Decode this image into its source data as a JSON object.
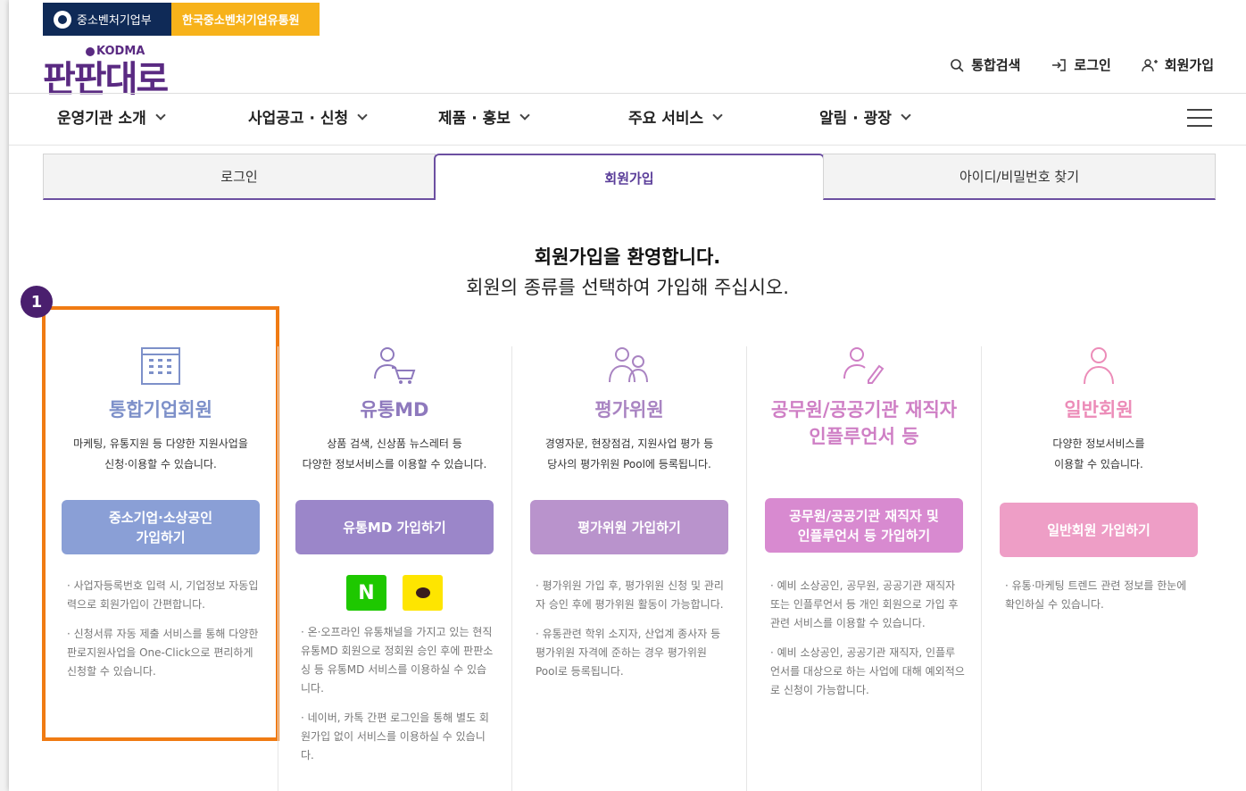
{
  "gov_bar": {
    "ministry": "중소벤처기업부",
    "agency": "한국중소벤처기업유통원"
  },
  "logo": {
    "text": "판판대로",
    "sub": "KODMA"
  },
  "utility": {
    "search": "통합검색",
    "login": "로그인",
    "signup": "회원가입"
  },
  "main_nav": [
    "운영기관 소개",
    "사업공고 · 신청",
    "제품 · 홍보",
    "주요 서비스",
    "알림 · 광장"
  ],
  "tabs": [
    "로그인",
    "회원가입",
    "아이디/비밀번호 찾기"
  ],
  "welcome": {
    "title": "회원가입을 환영합니다.",
    "subtitle": "회원의 종류를 선택하여 가입해 주십시오."
  },
  "badge": "1",
  "columns": [
    {
      "title": "통합기업회원",
      "desc1": "마케팅, 유통지원 등 다양한 지원사업을",
      "desc2": "신청·이용할 수 있습니다.",
      "button": "중소기업·소상공인\n가입하기",
      "notes": [
        "· 사업자등록번호 입력 시, 기업정보 자동입력으로 회원가입이 간편합니다.",
        "· 신청서류 자동 제출 서비스를 통해 다양한 판로지원사업을 One-Click으로 편리하게 신청할 수 있습니다."
      ]
    },
    {
      "title": "유통MD",
      "desc1": "상품 검색, 신상품 뉴스레터 등",
      "desc2": "다양한 정보서비스를 이용할 수 있습니다.",
      "button": "유통MD 가입하기",
      "sns": [
        "N",
        "kakao"
      ],
      "notes": [
        "· 온·오프라인 유통채널을 가지고 있는 현직 유통MD 회원으로 정회원 승인 후에 판판소싱 등 유통MD 서비스를 이용하실 수 있습니다.",
        "· 네이버, 카톡 간편 로그인을 통해 별도 회원가입 없이 서비스를 이용하실 수 있습니다."
      ]
    },
    {
      "title": "평가위원",
      "desc1": "경영자문, 현장점검, 지원사업 평가 등",
      "desc2": "당사의 평가위원 Pool에 등록됩니다.",
      "button": "평가위원 가입하기",
      "notes": [
        "· 평가위원 가입 후, 평가위원 신청 및 관리자 승인 후에 평가위원 활동이 가능합니다.",
        "· 유통관련 학위 소지자, 산업계 종사자 등 평가위원 자격에 준하는 경우 평가위원 Pool로 등록됩니다."
      ]
    },
    {
      "title": "공무원/공공기관 재직자\n인플루언서 등",
      "desc1": "",
      "desc2": "",
      "button": "공무원/공공기관 재직자 및\n인플루언서 등 가입하기",
      "notes": [
        "· 예비 소상공인, 공무원, 공공기관 재직자 또는 인플루언서 등 개인 회원으로 가입 후 관련 서비스를 이용할 수 있습니다.",
        "· 예비 소상공인, 공공기관 재직자, 인플루언서를 대상으로 하는 사업에 대해 예외적으로 신청이 가능합니다."
      ]
    },
    {
      "title": "일반회원",
      "desc1": "다양한 정보서비스를",
      "desc2": "이용할 수 있습니다.",
      "button": "일반회원 가입하기",
      "notes": [
        "· 유통·마케팅 트렌드 관련 정보를 한눈에 확인하실 수 있습니다."
      ]
    }
  ],
  "colors": {
    "purple_dark": "#5a2a82",
    "tab_accent": "#6c4fa1",
    "highlight": "#f07b13",
    "col1": "#8a9fd6",
    "col2": "#9b86c9",
    "col3": "#b993cc",
    "col4": "#d88ad0",
    "col5": "#ee9ec6"
  }
}
